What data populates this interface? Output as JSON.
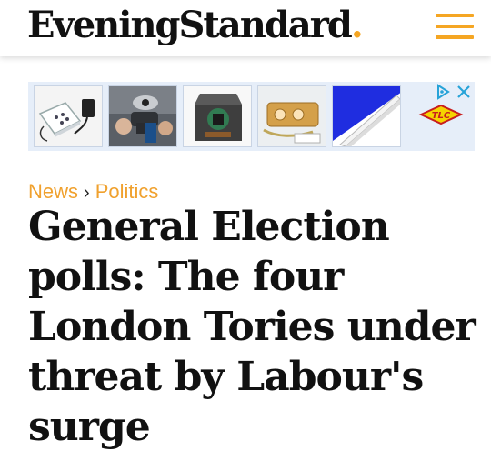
{
  "header": {
    "logo_text": "EveningStandard",
    "logo_dot": ".",
    "menu_icon": "hamburger-menu-icon",
    "accent_color": "#f5a623"
  },
  "ad": {
    "tiles": [
      {
        "icon": "wall-socket-product-image"
      },
      {
        "icon": "power-drill-product-image"
      },
      {
        "icon": "electrical-box-product-image"
      },
      {
        "icon": "cable-connector-product-image"
      },
      {
        "icon": "cable-trunking-product-image"
      }
    ],
    "brand_logo_text": "TLC",
    "adchoices_icon": "adchoices-icon",
    "close_icon": "close-icon"
  },
  "breadcrumb": {
    "section": "News",
    "separator": "›",
    "subsection": "Politics"
  },
  "article": {
    "headline": "General Election polls: The four London Tories under threat by Labour's surge"
  }
}
